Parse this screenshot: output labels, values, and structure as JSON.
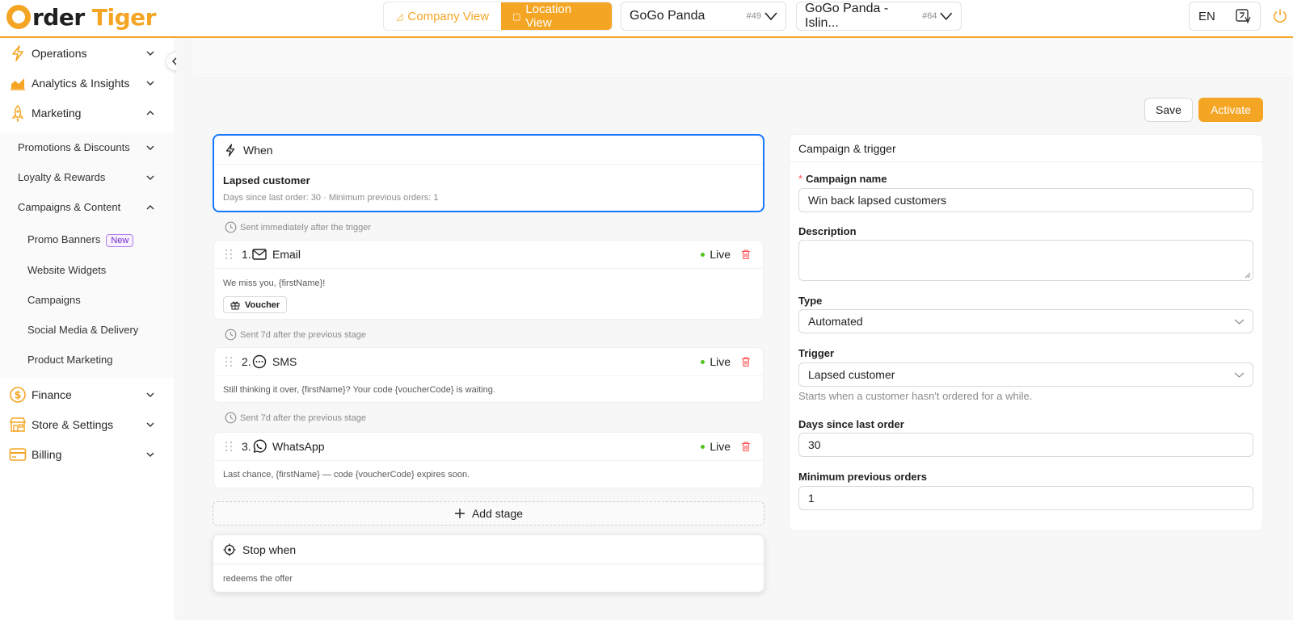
{
  "header": {
    "logo_left": "rder",
    "logo_right": "Tiger",
    "company_view_label": "Company View",
    "location_view_label": "Location View",
    "company_select": {
      "value": "GoGo Panda",
      "id": "#49"
    },
    "location_select": {
      "value": "GoGo Panda - Islin...",
      "id": "#64"
    },
    "language": "EN",
    "accent_color": "#f5a524"
  },
  "sidebar": {
    "items": [
      {
        "label": "Operations",
        "icon": "lightning-icon"
      },
      {
        "label": "Analytics & Insights",
        "icon": "chart-icon"
      },
      {
        "label": "Marketing",
        "icon": "rocket-icon"
      },
      {
        "label": "Finance",
        "icon": "dollar-icon"
      },
      {
        "label": "Store & Settings",
        "icon": "store-icon"
      },
      {
        "label": "Billing",
        "icon": "card-icon"
      }
    ],
    "marketing_sub": [
      {
        "label": "Promotions & Discounts"
      },
      {
        "label": "Loyalty & Rewards"
      },
      {
        "label": "Campaigns & Content"
      }
    ],
    "campaigns_sub": [
      {
        "label": "Promo Banners",
        "badge": "New"
      },
      {
        "label": "Website Widgets"
      },
      {
        "label": "Campaigns"
      },
      {
        "label": "Social Media & Delivery"
      },
      {
        "label": "Product Marketing"
      }
    ]
  },
  "toolbar": {
    "save_label": "Save",
    "activate_label": "Activate"
  },
  "flow": {
    "when": {
      "header": "When",
      "title": "Lapsed customer",
      "subtitle": "Days since last order: 30 · Minimum previous orders: 1"
    },
    "delays": [
      "Sent immediately after the trigger",
      "Sent 7d after the previous stage",
      "Sent 7d after the previous stage"
    ],
    "stages": [
      {
        "number": "1.",
        "channel": "Email",
        "status": "Live",
        "message": "We miss you, {firstName}!",
        "tag": "Voucher"
      },
      {
        "number": "2.",
        "channel": "SMS",
        "status": "Live",
        "message": "Still thinking it over, {firstName}? Your code {voucherCode} is waiting."
      },
      {
        "number": "3.",
        "channel": "WhatsApp",
        "status": "Live",
        "message": "Last chance, {firstName} — code {voucherCode} expires soon."
      }
    ],
    "add_stage_label": "Add stage",
    "stop": {
      "header": "Stop when",
      "subtitle": "redeems the offer"
    }
  },
  "panel": {
    "title": "Campaign & trigger",
    "campaign_name_label": "Campaign name",
    "campaign_name_value": "Win back lapsed customers",
    "description_label": "Description",
    "description_value": "",
    "type_label": "Type",
    "type_value": "Automated",
    "trigger_label": "Trigger",
    "trigger_value": "Lapsed customer",
    "trigger_help": "Starts when a customer hasn't ordered for a while.",
    "days_label": "Days since last order",
    "days_value": "30",
    "min_orders_label": "Minimum previous orders",
    "min_orders_value": "1"
  }
}
